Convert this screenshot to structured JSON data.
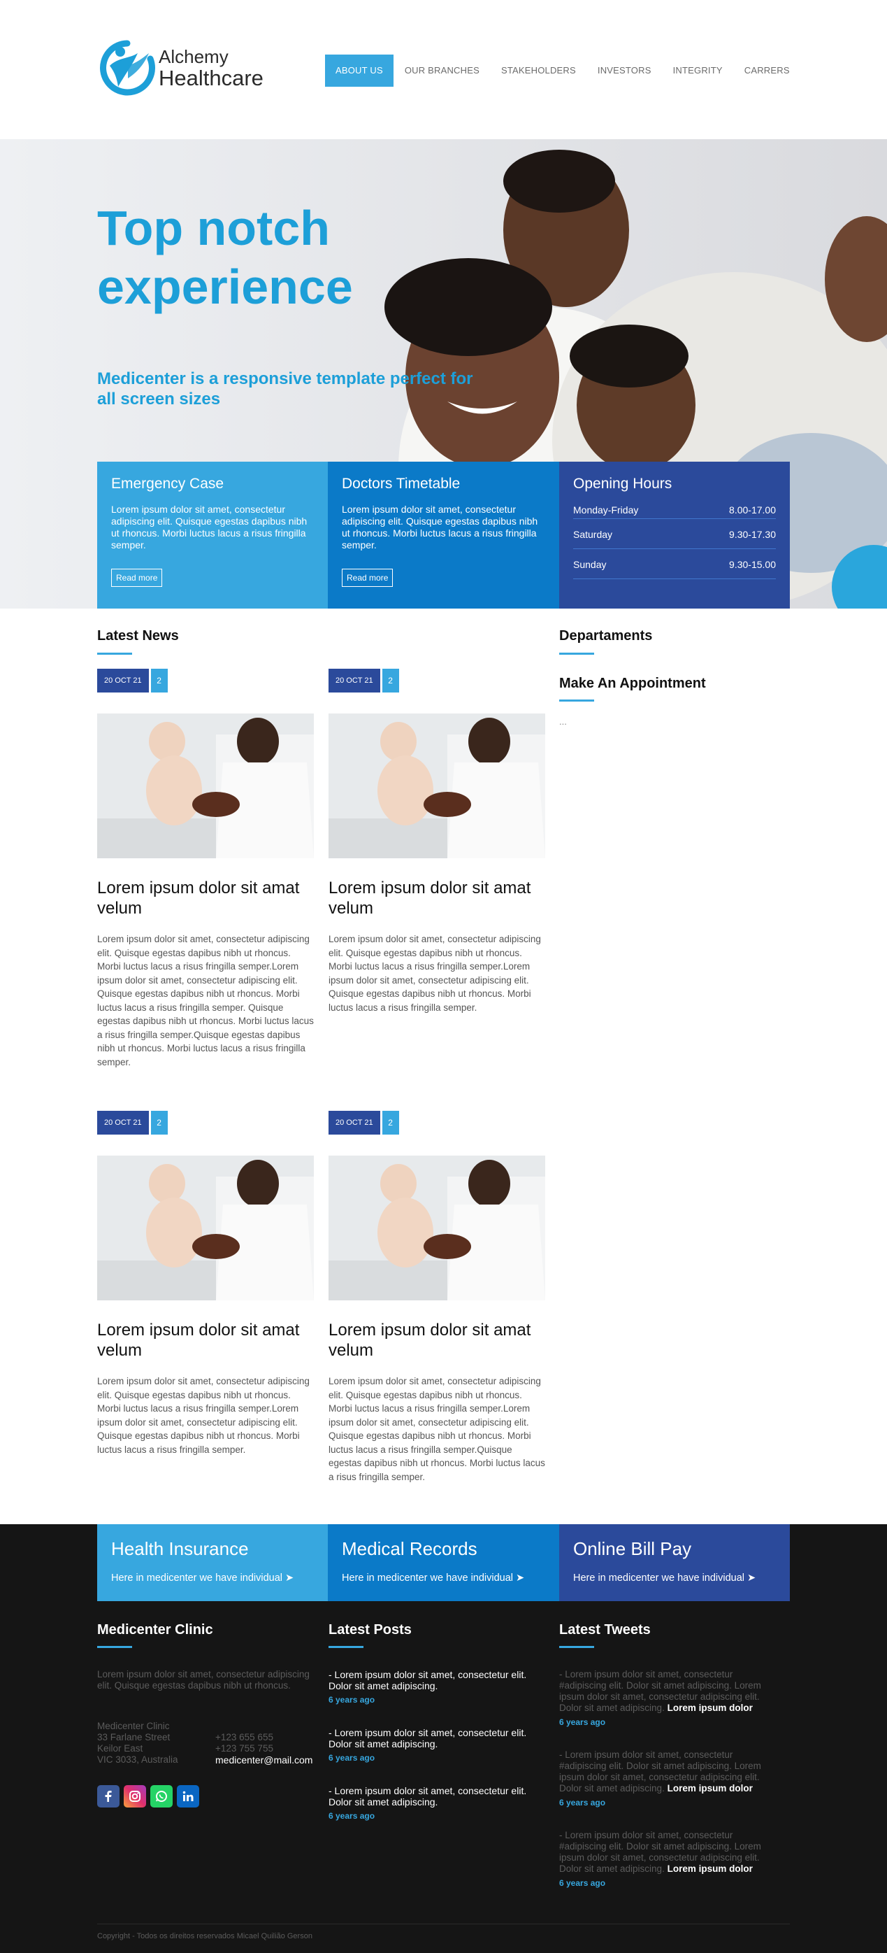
{
  "header": {
    "logo_line1": "Alchemy",
    "logo_line2": "Healthcare",
    "nav": [
      "ABOUT US",
      "OUR BRANCHES",
      "STAKEHOLDERS",
      "INVESTORS",
      "INTEGRITY",
      "CARRERS"
    ],
    "active_nav": "ABOUT US"
  },
  "hero": {
    "title": "Top notch experience",
    "subtitle": "Medicenter is a responsive template perfect for all screen sizes"
  },
  "boxes": {
    "emergency": {
      "title": "Emergency Case",
      "text": "Lorem ipsum dolor sit amet, consectetur adipiscing elit. Quisque egestas dapibus nibh ut rhoncus. Morbi luctus lacus a risus fringilla semper.",
      "button": "Read more"
    },
    "timetable": {
      "title": "Doctors Timetable",
      "text": "Lorem ipsum dolor sit amet, consectetur adipiscing elit. Quisque egestas dapibus nibh ut rhoncus. Morbi luctus lacus a risus fringilla semper.",
      "button": "Read more"
    },
    "hours": {
      "title": "Opening Hours",
      "rows": [
        {
          "day": "Monday-Friday",
          "time": "8.00-17.00"
        },
        {
          "day": "Saturday",
          "time": "9.30-17.30"
        },
        {
          "day": "Sunday",
          "time": "9.30-15.00"
        }
      ]
    }
  },
  "news": {
    "title": "Latest News",
    "posts": [
      {
        "date": "20 OCT 21",
        "comments": "2",
        "title": "Lorem ipsum dolor sit amat velum",
        "text": "Lorem ipsum dolor sit amet, consectetur adipiscing elit. Quisque egestas dapibus nibh ut rhoncus. Morbi luctus lacus a risus fringilla semper.Lorem ipsum dolor sit amet, consectetur adipiscing elit. Quisque egestas dapibus nibh ut rhoncus. Morbi luctus lacus a risus fringilla semper. Quisque egestas dapibus nibh ut rhoncus. Morbi luctus lacus a risus fringilla semper.Quisque egestas dapibus nibh ut rhoncus. Morbi luctus lacus a risus fringilla semper."
      },
      {
        "date": "20 OCT 21",
        "comments": "2",
        "title": "Lorem ipsum dolor sit amat velum",
        "text": "Lorem ipsum dolor sit amet, consectetur adipiscing elit. Quisque egestas dapibus nibh ut rhoncus. Morbi luctus lacus a risus fringilla semper.Lorem ipsum dolor sit amet, consectetur adipiscing elit. Quisque egestas dapibus nibh ut rhoncus. Morbi luctus lacus a risus fringilla semper."
      },
      {
        "date": "20 OCT 21",
        "comments": "2",
        "title": "Lorem ipsum dolor sit amat velum",
        "text": "Lorem ipsum dolor sit amet, consectetur adipiscing elit. Quisque egestas dapibus nibh ut rhoncus. Morbi luctus lacus a risus fringilla semper.Lorem ipsum dolor sit amet, consectetur adipiscing elit. Quisque egestas dapibus nibh ut rhoncus. Morbi luctus lacus a risus fringilla semper."
      },
      {
        "date": "20 OCT 21",
        "comments": "2",
        "title": "Lorem ipsum dolor sit amat velum",
        "text": "Lorem ipsum dolor sit amet, consectetur adipiscing elit. Quisque egestas dapibus nibh ut rhoncus. Morbi luctus lacus a risus fringilla semper.Lorem ipsum dolor sit amet, consectetur adipiscing elit. Quisque egestas dapibus nibh ut rhoncus. Morbi luctus lacus a risus fringilla semper.Quisque egestas dapibus nibh ut rhoncus. Morbi luctus lacus a risus fringilla semper."
      }
    ]
  },
  "sidebar": {
    "departments": "Departaments",
    "appointment": "Make An Appointment",
    "placeholder": "..."
  },
  "footer_boxes": [
    {
      "title": "Health Insurance",
      "text": "Here in medicenter we have individual ➤"
    },
    {
      "title": "Medical Records",
      "text": "Here in medicenter we have individual ➤"
    },
    {
      "title": "Online Bill Pay",
      "text": "Here in medicenter we have individual ➤"
    }
  ],
  "clinic": {
    "title": "Medicenter Clinic",
    "intro": "Lorem ipsum dolor sit amet, consectetur adipiscing elit. Quisque egestas dapibus nibh ut rhoncus.",
    "address": [
      "Medicenter Clinic",
      "33 Farlane Street",
      "Keilor East",
      "VIC 3033, Australia"
    ],
    "phone1": "+123 655 655",
    "phone2": "+123 755 755",
    "email": "medicenter@mail.com"
  },
  "posts": {
    "title": "Latest Posts",
    "items": [
      {
        "text": "- Lorem ipsum dolor sit amet, consectetur elit. Dolor sit amet adipiscing.",
        "time": "6 years ago"
      },
      {
        "text": "- Lorem ipsum dolor sit amet, consectetur elit. Dolor sit amet adipiscing.",
        "time": "6 years ago"
      },
      {
        "text": "- Lorem ipsum dolor sit amet, consectetur elit. Dolor sit amet adipiscing.",
        "time": "6 years ago"
      }
    ]
  },
  "tweets": {
    "title": "Latest Tweets",
    "items": [
      {
        "text": "- Lorem ipsum dolor sit amet, consectetur #adipiscing elit. Dolor sit amet adipiscing. Lorem ipsum dolor sit amet, consectetur adipiscing elit. Dolor sit amet adipiscing.",
        "bold": "Lorem ipsum dolor",
        "time": "6 years ago"
      },
      {
        "text": "- Lorem ipsum dolor sit amet, consectetur #adipiscing elit. Dolor sit amet adipiscing. Lorem ipsum dolor sit amet, consectetur adipiscing elit. Dolor sit amet adipiscing.",
        "bold": "Lorem ipsum dolor",
        "time": "6 years ago"
      },
      {
        "text": "- Lorem ipsum dolor sit amet, consectetur #adipiscing elit. Dolor sit amet adipiscing. Lorem ipsum dolor sit amet, consectetur adipiscing elit. Dolor sit amet adipiscing.",
        "bold": "Lorem ipsum dolor",
        "time": "6 years ago"
      }
    ]
  },
  "social_icons": [
    "facebook-icon",
    "instagram-icon",
    "whatsapp-icon",
    "linkedin-icon"
  ],
  "copyright": "Copyright - Todos os direitos reservados Micael Quilião Gerson",
  "colors": {
    "accent": "#37a7df",
    "mid_blue": "#0b7ac8",
    "dark_blue": "#2b4a9b",
    "footer_bg": "#151515"
  }
}
